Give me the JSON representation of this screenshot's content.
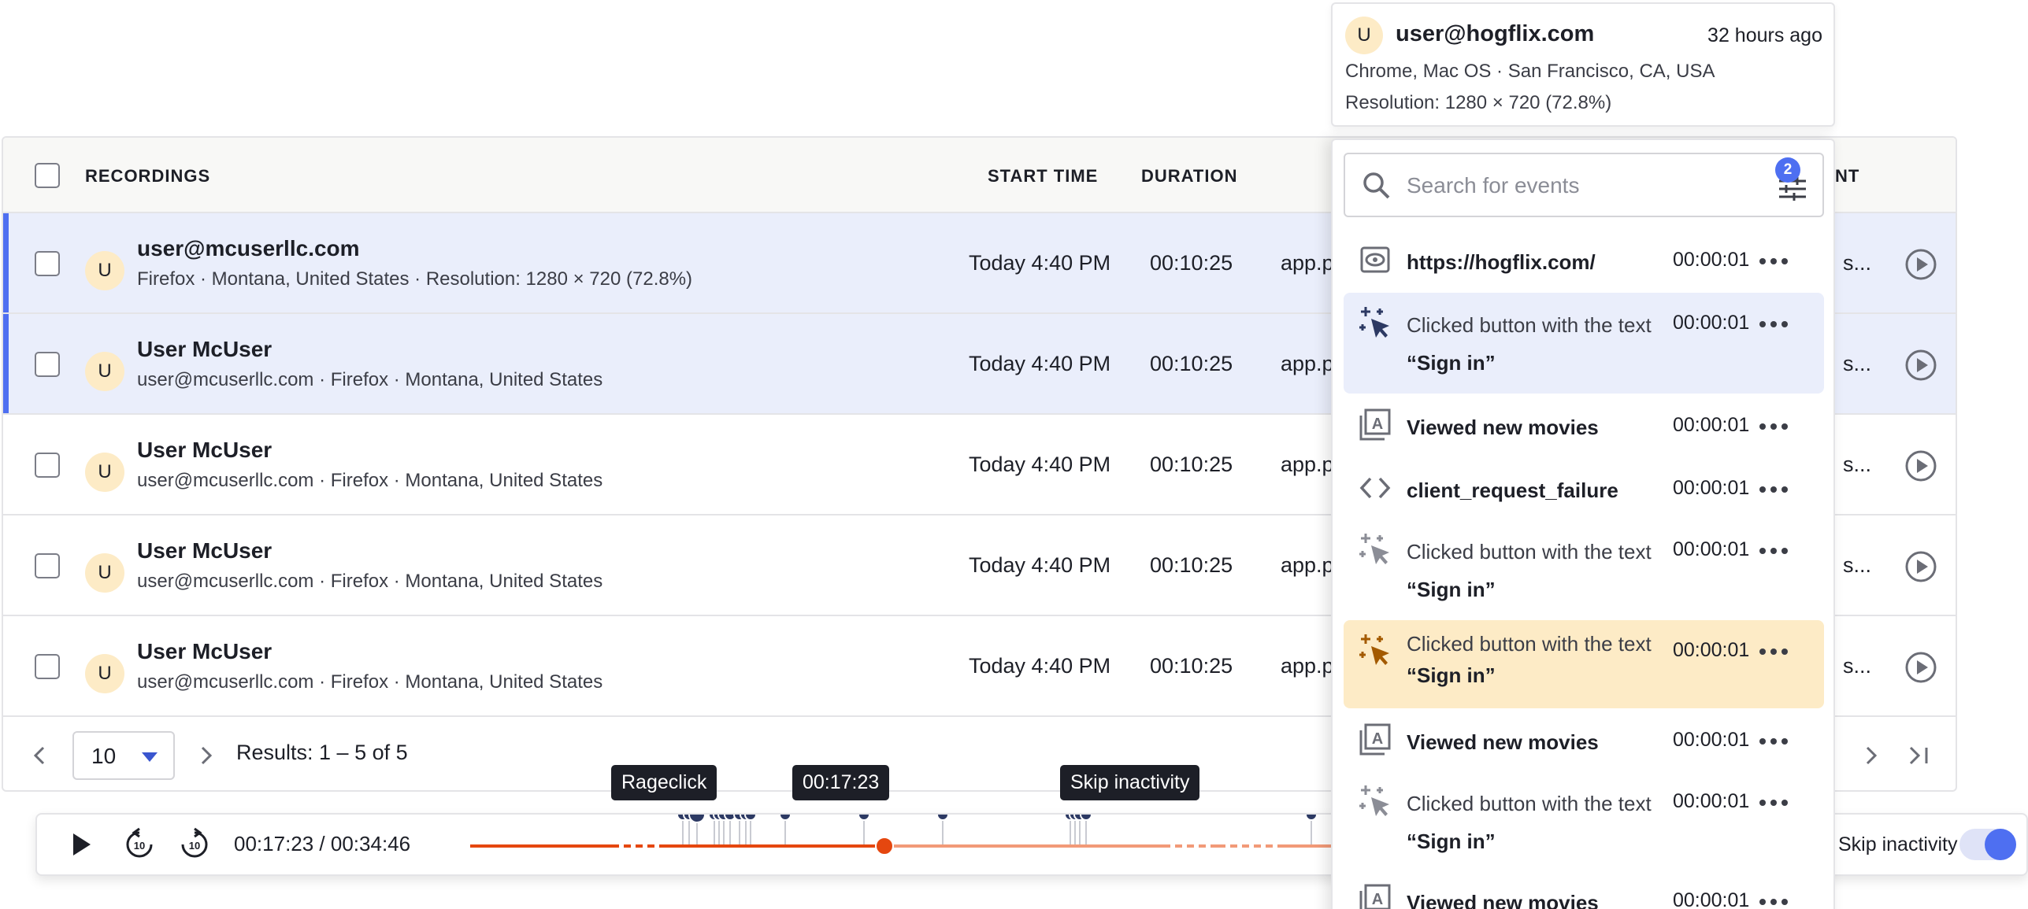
{
  "table": {
    "columns": {
      "recordings": "RECORDINGS",
      "start_time": "START TIME",
      "duration": "DURATION",
      "trailing_partial": "NT"
    },
    "rows": [
      {
        "avatar": "U",
        "title": "user@mcuserllc.com",
        "subtitle": "Firefox · Montana, United States · Resolution: 1280 × 720 (72.8%)",
        "start": "Today 4:40 PM",
        "duration": "00:10:25",
        "url": "app.p",
        "tail": "s..."
      },
      {
        "avatar": "U",
        "title": "User McUser",
        "subtitle": "user@mcuserllc.com · Firefox · Montana, United States",
        "start": "Today 4:40 PM",
        "duration": "00:10:25",
        "url": "app.p",
        "tail": "s..."
      },
      {
        "avatar": "U",
        "title": "User McUser",
        "subtitle": "user@mcuserllc.com · Firefox · Montana, United States",
        "start": "Today 4:40 PM",
        "duration": "00:10:25",
        "url": "app.p",
        "tail": "s..."
      },
      {
        "avatar": "U",
        "title": "User McUser",
        "subtitle": "user@mcuserllc.com · Firefox · Montana, United States",
        "start": "Today 4:40 PM",
        "duration": "00:10:25",
        "url": "app.p",
        "tail": "s..."
      },
      {
        "avatar": "U",
        "title": "User McUser",
        "subtitle": "user@mcuserllc.com · Firefox · Montana, United States",
        "start": "Today 4:40 PM",
        "duration": "00:10:25",
        "url": "app.p",
        "tail": "s..."
      }
    ],
    "pagination": {
      "page_size": "10",
      "results": "Results: 1 – 5 of 5"
    }
  },
  "player": {
    "time": "00:17:23 / 00:34:46",
    "progress": 0.5,
    "tooltips": {
      "rageclick": "Rageclick",
      "current": "00:17:23",
      "skip": "Skip inactivity"
    },
    "skip_label": "Skip inactivity",
    "skip_enabled": true,
    "colors": {
      "played": "#e5470f",
      "remaining": "#f29a78",
      "marker": "#2c3963"
    }
  },
  "person": {
    "avatar": "U",
    "email": "user@hogflix.com",
    "last_seen": "32 hours ago",
    "device": "Chrome, Mac OS · San Francisco, CA, USA",
    "resolution": "Resolution: 1280 × 720 (72.8%)"
  },
  "events_panel": {
    "search_placeholder": "Search for events",
    "filter_count": "2",
    "events": [
      {
        "icon": "eye-icon",
        "label": "https://hogflix.com/",
        "time": "00:00:01"
      },
      {
        "icon": "cursor-click-icon",
        "pre": "Clicked button with the text ",
        "em": "“Sign in”",
        "time": "00:00:01"
      },
      {
        "icon": "autocapture-icon",
        "label": "Viewed new movies",
        "time": "00:00:01"
      },
      {
        "icon": "code-icon",
        "label": "client_request_failure",
        "time": "00:00:01"
      },
      {
        "icon": "cursor-click-icon",
        "pre": "Clicked button with the text ",
        "em": "“Sign in”",
        "time": "00:00:01"
      },
      {
        "icon": "rageclick-icon",
        "pre": "Clicked button with the text ",
        "em": "“Sign in”",
        "time": "00:00:01"
      },
      {
        "icon": "autocapture-icon",
        "label": "Viewed new movies",
        "time": "00:00:01"
      },
      {
        "icon": "cursor-click-icon",
        "pre": "Clicked button with the text ",
        "em": "“Sign in”",
        "time": "00:00:01"
      },
      {
        "icon": "autocapture-icon",
        "label": "Viewed new movies",
        "time": "00:00:01"
      }
    ]
  }
}
